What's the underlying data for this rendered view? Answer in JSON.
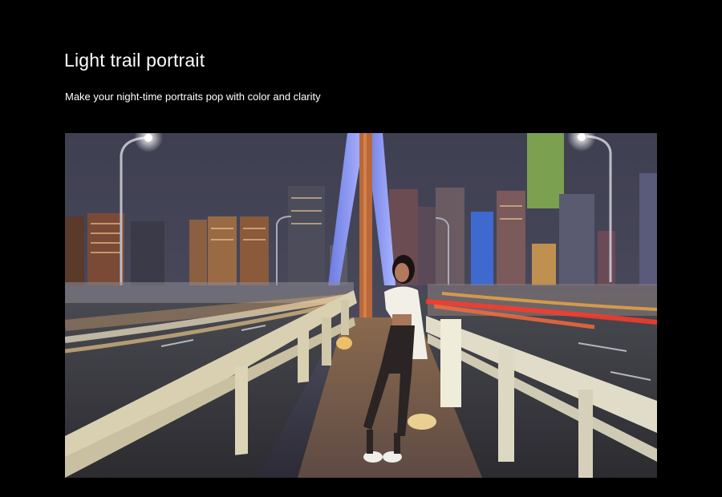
{
  "feature": {
    "title": "Light trail portrait",
    "subtitle": "Make your night-time portraits pop with color and clarity"
  },
  "photo": {
    "icon": "night-city-bridge-portrait-photo"
  }
}
